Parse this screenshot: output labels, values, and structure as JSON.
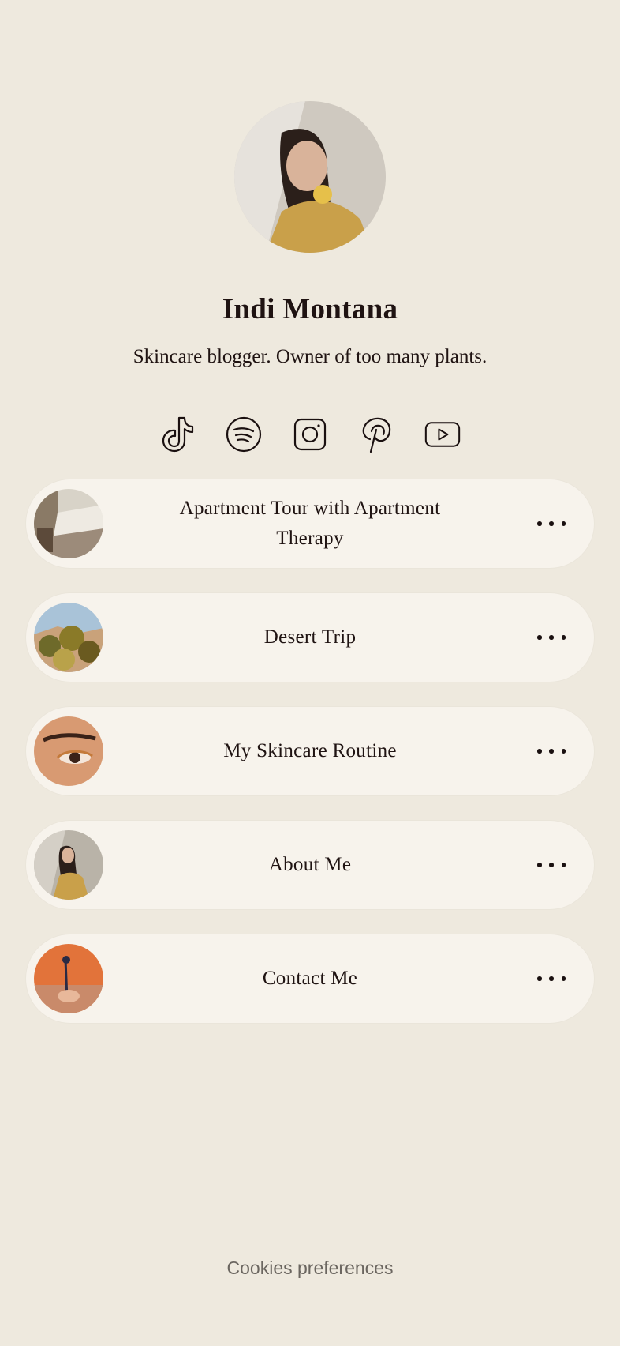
{
  "profile": {
    "name": "Indi Montana",
    "bio": "Skincare blogger. Owner of too many plants."
  },
  "socials": [
    {
      "icon": "tiktok-icon"
    },
    {
      "icon": "spotify-icon"
    },
    {
      "icon": "instagram-icon"
    },
    {
      "icon": "pinterest-icon"
    },
    {
      "icon": "youtube-icon"
    }
  ],
  "links": [
    {
      "label": "Apartment Tour with Apartment Therapy"
    },
    {
      "label": "Desert Trip"
    },
    {
      "label": "My Skincare Routine"
    },
    {
      "label": "About Me"
    },
    {
      "label": "Contact Me"
    }
  ],
  "footer": {
    "cookies": "Cookies preferences"
  },
  "colors": {
    "background": "#EEE9DE",
    "card": "#F7F3EC",
    "text": "#1F1312"
  }
}
